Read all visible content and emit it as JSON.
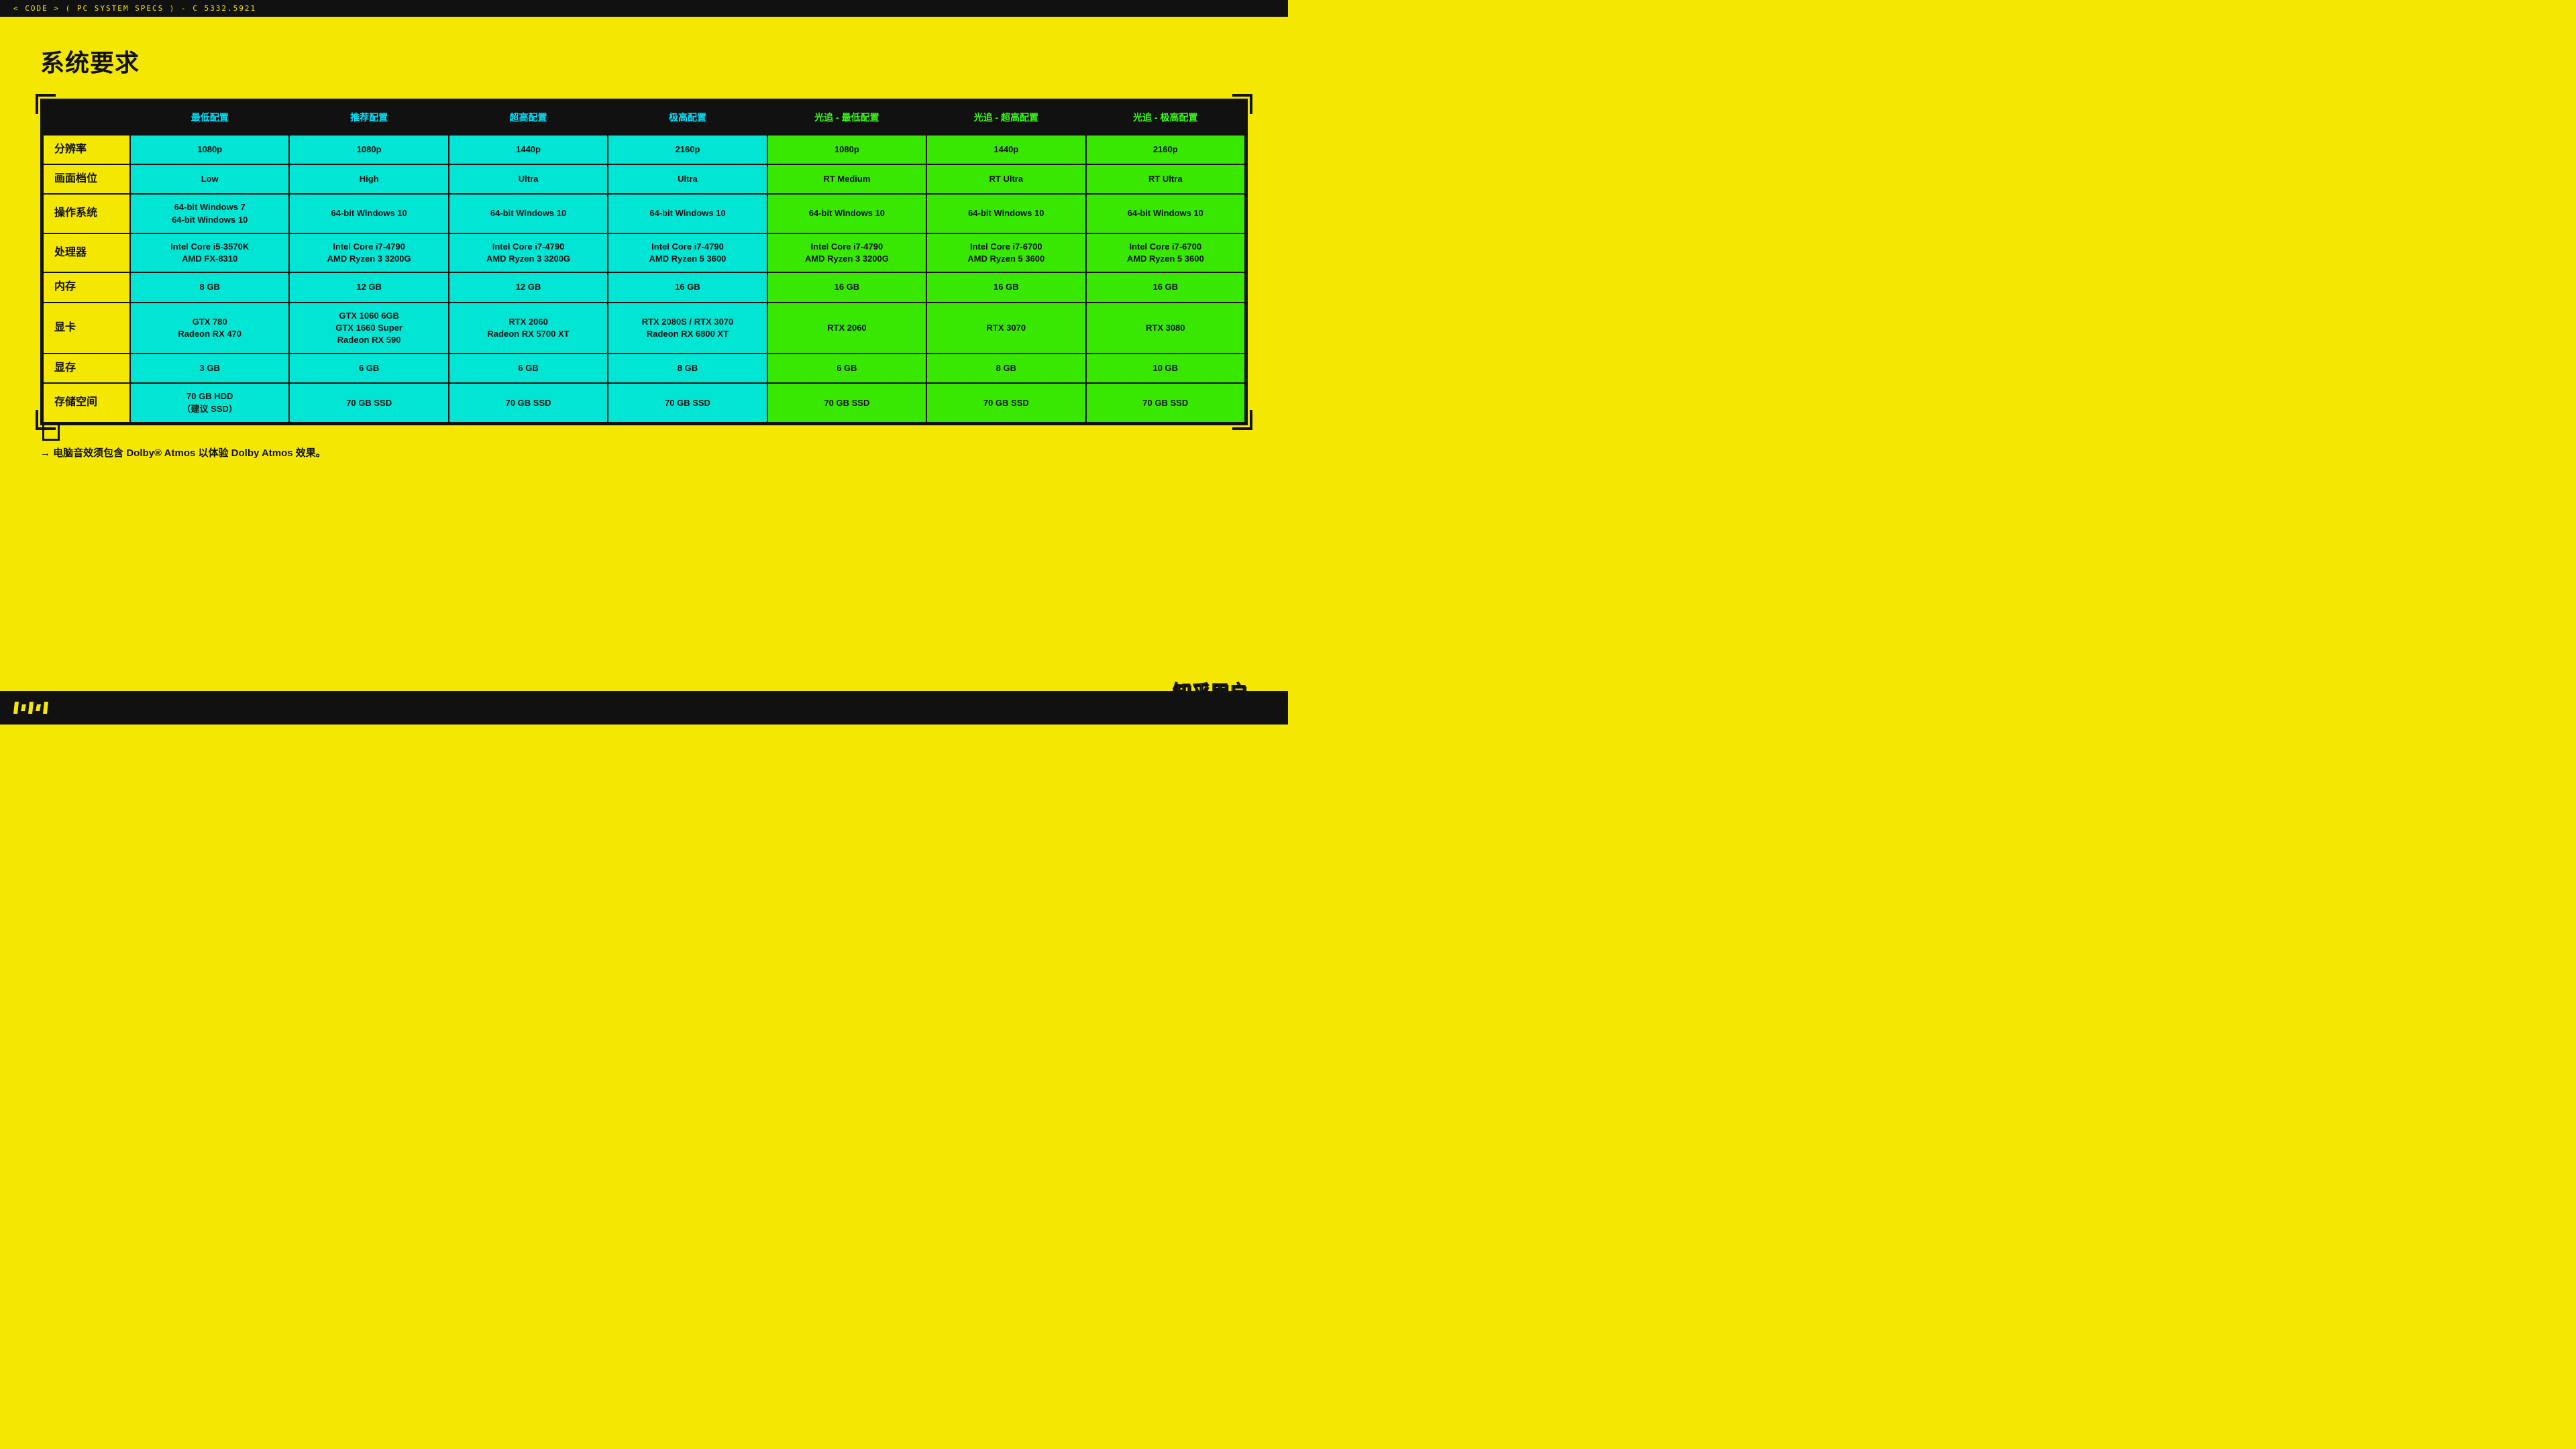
{
  "topbar": {
    "text": "< CODE > ( PC SYSTEM SPECS ) - C 5332.5921"
  },
  "title": "系统要求",
  "table": {
    "headers": [
      {
        "label": "",
        "class": ""
      },
      {
        "label": "最低配置",
        "class": "col-cyan"
      },
      {
        "label": "推荐配置",
        "class": "col-cyan"
      },
      {
        "label": "超高配置",
        "class": "col-cyan"
      },
      {
        "label": "极高配置",
        "class": "col-cyan"
      },
      {
        "label": "光追 - 最低配置",
        "class": "col-green"
      },
      {
        "label": "光追 - 超高配置",
        "class": "col-green"
      },
      {
        "label": "光追 - 极高配置",
        "class": "col-green"
      }
    ],
    "rows": [
      {
        "label": "分辨率",
        "cells": [
          {
            "value": "1080p",
            "class": "cyan"
          },
          {
            "value": "1080p",
            "class": "cyan"
          },
          {
            "value": "1440p",
            "class": "cyan"
          },
          {
            "value": "2160p",
            "class": "cyan"
          },
          {
            "value": "1080p",
            "class": "green"
          },
          {
            "value": "1440p",
            "class": "green"
          },
          {
            "value": "2160p",
            "class": "green"
          }
        ]
      },
      {
        "label": "画面档位",
        "cells": [
          {
            "value": "Low",
            "class": "cyan"
          },
          {
            "value": "High",
            "class": "cyan"
          },
          {
            "value": "Ultra",
            "class": "cyan"
          },
          {
            "value": "Ultra",
            "class": "cyan"
          },
          {
            "value": "RT Medium",
            "class": "green"
          },
          {
            "value": "RT Ultra",
            "class": "green"
          },
          {
            "value": "RT Ultra",
            "class": "green"
          }
        ]
      },
      {
        "label": "操作系统",
        "cells": [
          {
            "value": "64-bit Windows 7\n64-bit Windows 10",
            "class": "cyan"
          },
          {
            "value": "64-bit Windows 10",
            "class": "cyan"
          },
          {
            "value": "64-bit Windows 10",
            "class": "cyan"
          },
          {
            "value": "64-bit Windows 10",
            "class": "cyan"
          },
          {
            "value": "64-bit Windows 10",
            "class": "green"
          },
          {
            "value": "64-bit Windows 10",
            "class": "green"
          },
          {
            "value": "64-bit Windows 10",
            "class": "green"
          }
        ]
      },
      {
        "label": "处理器",
        "cells": [
          {
            "value": "Intel Core i5-3570K\nAMD FX-8310",
            "class": "cyan"
          },
          {
            "value": "Intel Core i7-4790\nAMD Ryzen 3 3200G",
            "class": "cyan"
          },
          {
            "value": "Intel Core i7-4790\nAMD Ryzen 3 3200G",
            "class": "cyan"
          },
          {
            "value": "Intel Core i7-4790\nAMD Ryzen 5 3600",
            "class": "cyan"
          },
          {
            "value": "Intel Core i7-4790\nAMD Ryzen 3 3200G",
            "class": "green"
          },
          {
            "value": "Intel Core i7-6700\nAMD Ryzen 5 3600",
            "class": "green"
          },
          {
            "value": "Intel Core i7-6700\nAMD Ryzen 5 3600",
            "class": "green"
          }
        ]
      },
      {
        "label": "内存",
        "cells": [
          {
            "value": "8 GB",
            "class": "cyan"
          },
          {
            "value": "12 GB",
            "class": "cyan"
          },
          {
            "value": "12 GB",
            "class": "cyan"
          },
          {
            "value": "16 GB",
            "class": "cyan"
          },
          {
            "value": "16 GB",
            "class": "green"
          },
          {
            "value": "16 GB",
            "class": "green"
          },
          {
            "value": "16 GB",
            "class": "green"
          }
        ]
      },
      {
        "label": "显卡",
        "cells": [
          {
            "value": "GTX 780\nRadeon RX 470",
            "class": "cyan"
          },
          {
            "value": "GTX 1060 6GB\nGTX 1660 Super\nRadeon RX 590",
            "class": "cyan"
          },
          {
            "value": "RTX 2060\nRadeon RX 5700 XT",
            "class": "cyan"
          },
          {
            "value": "RTX 2080S / RTX 3070\nRadeon RX 6800 XT",
            "class": "cyan"
          },
          {
            "value": "RTX 2060",
            "class": "green"
          },
          {
            "value": "RTX 3070",
            "class": "green"
          },
          {
            "value": "RTX 3080",
            "class": "green"
          }
        ]
      },
      {
        "label": "显存",
        "cells": [
          {
            "value": "3 GB",
            "class": "cyan"
          },
          {
            "value": "6 GB",
            "class": "cyan"
          },
          {
            "value": "6 GB",
            "class": "cyan"
          },
          {
            "value": "8 GB",
            "class": "cyan"
          },
          {
            "value": "6 GB",
            "class": "green"
          },
          {
            "value": "8 GB",
            "class": "green"
          },
          {
            "value": "10 GB",
            "class": "green"
          }
        ]
      },
      {
        "label": "存储空间",
        "cells": [
          {
            "value": "70 GB HDD\n（建议 SSD）",
            "class": "cyan"
          },
          {
            "value": "70 GB SSD",
            "class": "cyan"
          },
          {
            "value": "70 GB SSD",
            "class": "cyan"
          },
          {
            "value": "70 GB SSD",
            "class": "cyan"
          },
          {
            "value": "70 GB SSD",
            "class": "green"
          },
          {
            "value": "70 GB SSD",
            "class": "green"
          },
          {
            "value": "70 GB SSD",
            "class": "green"
          }
        ]
      }
    ]
  },
  "footer_note": "→ 电脑音效须包含 Dolby® Atmos 以体验 Dolby Atmos 效果。",
  "watermark": "知乎用户"
}
